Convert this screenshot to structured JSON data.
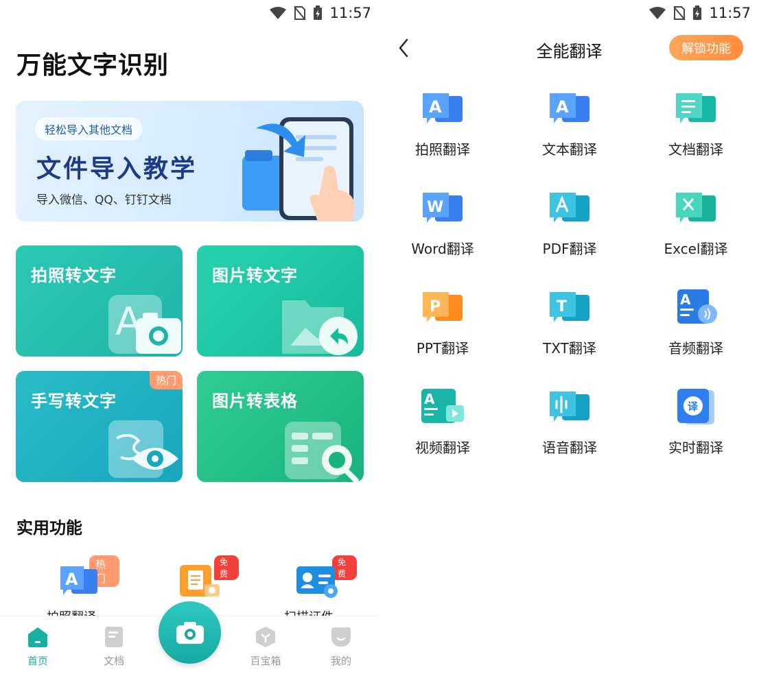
{
  "left": {
    "status": {
      "time": "11:57"
    },
    "app_title": "万能文字识别",
    "banner": {
      "pill": "轻松导入其他文档",
      "title": "文件导入教学",
      "subtitle": "导入微信、QQ、钉钉文档"
    },
    "cards": [
      {
        "label": "拍照转文字"
      },
      {
        "label": "图片转文字"
      },
      {
        "label": "手写转文字",
        "badge": "热门"
      },
      {
        "label": "图片转表格"
      }
    ],
    "section_title": "实用功能",
    "tools": [
      {
        "label": "拍照翻译",
        "badge": "热门"
      },
      {
        "label": "",
        "badge": "免费"
      },
      {
        "label": "扫描证件",
        "badge": "免费"
      }
    ],
    "tabbar": {
      "home": "首页",
      "docs": "文档",
      "box": "百宝箱",
      "me": "我的"
    },
    "colors": {
      "accent": "#17b0a3",
      "hot": "#ff9b6f",
      "free": "#f2413a"
    }
  },
  "right": {
    "status": {
      "time": "11:57"
    },
    "nav_title": "全能翻译",
    "unlock_label": "解锁功能",
    "grid": [
      {
        "label": "拍照翻译",
        "icon": "photo-translate-icon"
      },
      {
        "label": "文本翻译",
        "icon": "text-translate-icon"
      },
      {
        "label": "文档翻译",
        "icon": "document-translate-icon"
      },
      {
        "label": "Word翻译",
        "icon": "word-translate-icon"
      },
      {
        "label": "PDF翻译",
        "icon": "pdf-translate-icon"
      },
      {
        "label": "Excel翻译",
        "icon": "excel-translate-icon"
      },
      {
        "label": "PPT翻译",
        "icon": "ppt-translate-icon"
      },
      {
        "label": "TXT翻译",
        "icon": "txt-translate-icon"
      },
      {
        "label": "音频翻译",
        "icon": "audio-translate-icon"
      },
      {
        "label": "视频翻译",
        "icon": "video-translate-icon"
      },
      {
        "label": "语音翻译",
        "icon": "voice-translate-icon"
      },
      {
        "label": "实时翻译",
        "icon": "realtime-translate-icon"
      }
    ],
    "colors": {
      "unlock": "#ff8d3b"
    }
  }
}
